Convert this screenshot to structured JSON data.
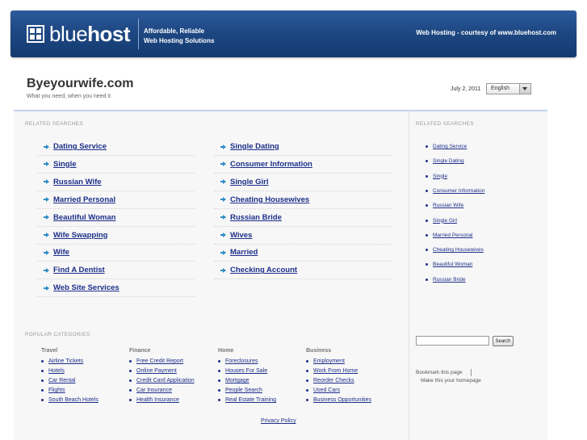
{
  "header": {
    "logo_light": "blue",
    "logo_bold": "host",
    "tagline_line1": "Affordable, Reliable",
    "tagline_line2": "Web Hosting Solutions",
    "courtesy": "Web Hosting - courtesy of www.bluehost.com"
  },
  "site": {
    "title": "Byeyourwife.com",
    "subtitle": "What you need, when you need it",
    "date": "July 2, 2011",
    "language": "English"
  },
  "related": {
    "label": "RELATED SEARCHES",
    "left_col": [
      "Dating Service",
      "Single",
      "Russian Wife",
      "Married Personal",
      "Beautiful Woman",
      "Wife Swapping",
      "Wife",
      "Find A Dentist",
      "Web Site Services"
    ],
    "right_col": [
      "Single Dating",
      "Consumer Information",
      "Single Girl",
      "Cheating Housewives",
      "Russian Bride",
      "Wives",
      "Married",
      "Checking Account"
    ]
  },
  "sidebar": {
    "label": "RELATED SEARCHES",
    "links": [
      "Dating Service",
      "Single Dating",
      "Single",
      "Consumer Information",
      "Russian Wife",
      "Single Girl",
      "Married Personal",
      "Cheating Housewives",
      "Beautiful Woman",
      "Russian Bride"
    ],
    "search_button": "Search",
    "bookmark": "Bookmark this page",
    "homepage": "Make this your homepage"
  },
  "categories": {
    "label": "POPULAR CATEGORIES",
    "groups": [
      {
        "name": "Travel",
        "items": [
          "Airline Tickets",
          "Hotels",
          "Car Rental",
          "Flights",
          "South Beach Hotels"
        ]
      },
      {
        "name": "Finance",
        "items": [
          "Free Credit Report",
          "Online Payment",
          "Credit Card Application",
          "Car Insurance",
          "Health Insurance"
        ]
      },
      {
        "name": "Home",
        "items": [
          "Foreclosures",
          "Houses For Sale",
          "Mortgage",
          "People Search",
          "Real Estate Training"
        ]
      },
      {
        "name": "Business",
        "items": [
          "Employment",
          "Work From Home",
          "Reorder Checks",
          "Used Cars",
          "Business Opportunities"
        ]
      }
    ]
  },
  "footer": {
    "privacy": "Privacy Policy"
  },
  "colors": {
    "header_blue": "#1e4883",
    "link_blue": "#1d2f8a",
    "arrow_blue": "#2c8cc4"
  }
}
